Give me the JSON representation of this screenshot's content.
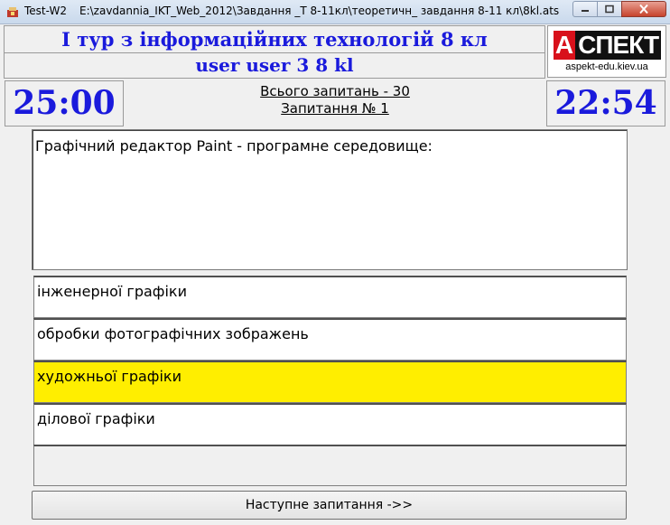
{
  "window": {
    "app_name": "Test-W2",
    "path": "E:\\zavdannia_IKT_Web_2012\\Завдання _Т 8-11кл\\теоретичн_ завдання  8-11 кл\\8kl.ats"
  },
  "header": {
    "title": "І тур з інформаційних технологій 8 кл",
    "user": "user user 3 8 kl"
  },
  "logo": {
    "first_letter": "А",
    "rest": "СПЕКТ",
    "url": "aspekt-edu.kiev.ua"
  },
  "timers": {
    "total": "25:00",
    "remaining": "22:54"
  },
  "question_info": {
    "total_label": "Всього запитань - 30",
    "current_label": "Запитання № 1"
  },
  "question": {
    "text": "Графічний редактор Paint - програмне середовище:"
  },
  "answers": [
    {
      "text": "інженерної графіки",
      "selected": false
    },
    {
      "text": "обробки фотографічних зображень",
      "selected": false
    },
    {
      "text": "художньої графіки",
      "selected": true
    },
    {
      "text": "ділової графіки",
      "selected": false
    }
  ],
  "next_button": {
    "label": "Наступне запитання ->>"
  },
  "colors": {
    "header_text": "#1a1adc",
    "selected_answer": "#ffee00",
    "logo_red": "#d8111b"
  }
}
